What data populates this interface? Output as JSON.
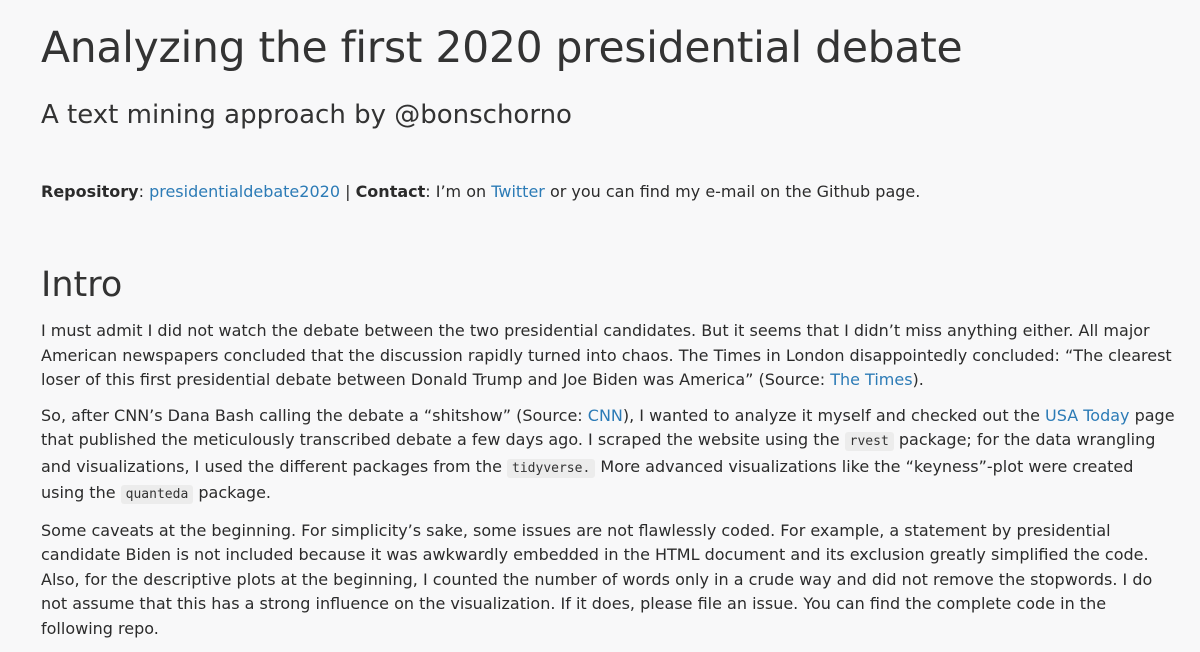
{
  "header": {
    "title": "Analyzing the first 2020 presidential debate",
    "subtitle": "A text mining approach by @bonschorno"
  },
  "meta": {
    "repo_label": "Repository",
    "repo_sep": ": ",
    "repo_link": "presidentialdebate2020",
    "divider": " | ",
    "contact_label": "Contact",
    "contact_text_1": ": I’m on ",
    "twitter_link": "Twitter",
    "contact_text_2": " or you can find my e-mail on the Github page."
  },
  "intro": {
    "heading": "Intro",
    "p1": {
      "text": "I must admit I did not watch the debate between the two presidential candidates. But it seems that I didn’t miss anything either. All major American newspapers concluded that the discussion rapidly turned into chaos. The Times in London disappointedly concluded: “The clearest loser of this first presidential debate between Donald Trump and Joe Biden was America” (Source: ",
      "link": "The Times",
      "end": ")."
    },
    "p2": {
      "t1": "So, after CNN’s Dana Bash calling the debate a “shitshow” (Source: ",
      "link_cnn": "CNN",
      "t2": "), I wanted to analyze it myself and checked out the ",
      "link_usa": "USA Today",
      "t3": " page that published the meticulously transcribed debate a few days ago. I scraped the website using the ",
      "code_rvest": "rvest",
      "t4": " package; for the data wrangling and visualizations, I used the different packages from the ",
      "code_tidyverse": "tidyverse.",
      "t5": " More advanced visualizations like the “keyness”-plot were created using the ",
      "code_quanteda": "quanteda",
      "t6": " package."
    },
    "p3": "Some caveats at the beginning. For simplicity’s sake, some issues are not flawlessly coded. For example, a statement by presidential candidate Biden is not included because it was awkwardly embedded in the HTML document and its exclusion greatly simplified the code. Also, for the descriptive plots at the beginning, I counted the number of words only in a crude way and did not remove the stopwords. I do not assume that this has a strong influence on the visualization. If it does, please file an issue. You can find the complete code in the following repo."
  }
}
